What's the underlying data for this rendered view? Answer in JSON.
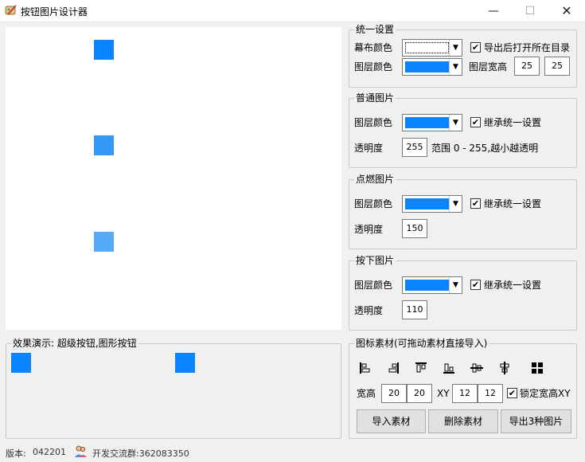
{
  "window": {
    "title": "按钮图片设计器",
    "min_glyph": "—",
    "max_glyph": "☐",
    "close_glyph": "✕"
  },
  "colors": {
    "layer_normal": "#0a84ff",
    "layer_hover": "#3399f4",
    "layer_pressed": "#55aaf7",
    "demo": "#0a84ff"
  },
  "unified": {
    "legend": "统一设置",
    "canvas_color_label": "幕布颜色",
    "layer_color_label": "图层颜色",
    "open_dir_label": "导出后打开所在目录",
    "open_dir_checked": true,
    "size_label": "图层宽高",
    "width": "25",
    "height": "25"
  },
  "normal": {
    "legend": "普通图片",
    "layer_color_label": "图层颜色",
    "inherit_label": "继承统一设置",
    "inherit_checked": true,
    "alpha_label": "透明度",
    "alpha": "255",
    "range_text": "范围 0 - 255,越小越透明"
  },
  "hover": {
    "legend": "点燃图片",
    "layer_color_label": "图层颜色",
    "inherit_label": "继承统一设置",
    "inherit_checked": true,
    "alpha_label": "透明度",
    "alpha": "150"
  },
  "pressed": {
    "legend": "按下图片",
    "layer_color_label": "图层颜色",
    "inherit_label": "继承统一设置",
    "inherit_checked": true,
    "alpha_label": "透明度",
    "alpha": "110"
  },
  "material": {
    "legend": "图标素材(可拖动素材直接导入)",
    "size_label": "宽高",
    "w": "20",
    "h": "20",
    "xy_label": "XY",
    "x": "12",
    "y": "12",
    "lock_label": "锁定宽高XY",
    "lock_checked": true,
    "import_label": "导入素材",
    "delete_label": "删除素材",
    "export_label": "导出3种图片",
    "align_icons": [
      "align-left-icon",
      "align-right-icon",
      "align-top-icon",
      "align-bottom-icon",
      "align-hcenter-icon",
      "align-vcenter-icon",
      "grid-icon"
    ]
  },
  "demo": {
    "legend": "效果演示: 超级按钮,图形按钮"
  },
  "status": {
    "version_label": "版本:",
    "version": "042201",
    "group_text": "开发交流群:362083350"
  }
}
